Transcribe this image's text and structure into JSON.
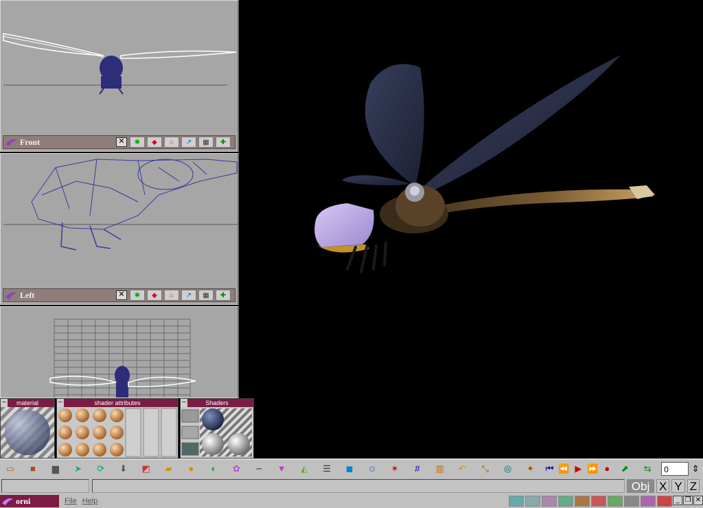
{
  "viewports": [
    {
      "label": "Front",
      "close": "✕"
    },
    {
      "label": "Left",
      "close": "✕"
    }
  ],
  "panels": {
    "material": {
      "title": "material",
      "min": "–"
    },
    "shader_attributes": {
      "title": "shader attributes",
      "min": "–"
    },
    "shaders": {
      "title": "Shaders",
      "min": "–"
    }
  },
  "toolbar": {
    "frame_value": "0"
  },
  "status": {
    "obj": "Obj",
    "x": "X",
    "y": "Y",
    "z": "Z"
  },
  "menubar": {
    "app_name": "orni",
    "menus": [
      "File",
      "Help"
    ]
  },
  "window_controls": {
    "minimize": "_",
    "restore": "❐",
    "close": "✕"
  },
  "colors": {
    "panel_header": "#7a1c44",
    "viewport_bg": "#a6a6a6",
    "wireframe": "#2a2a8a"
  }
}
